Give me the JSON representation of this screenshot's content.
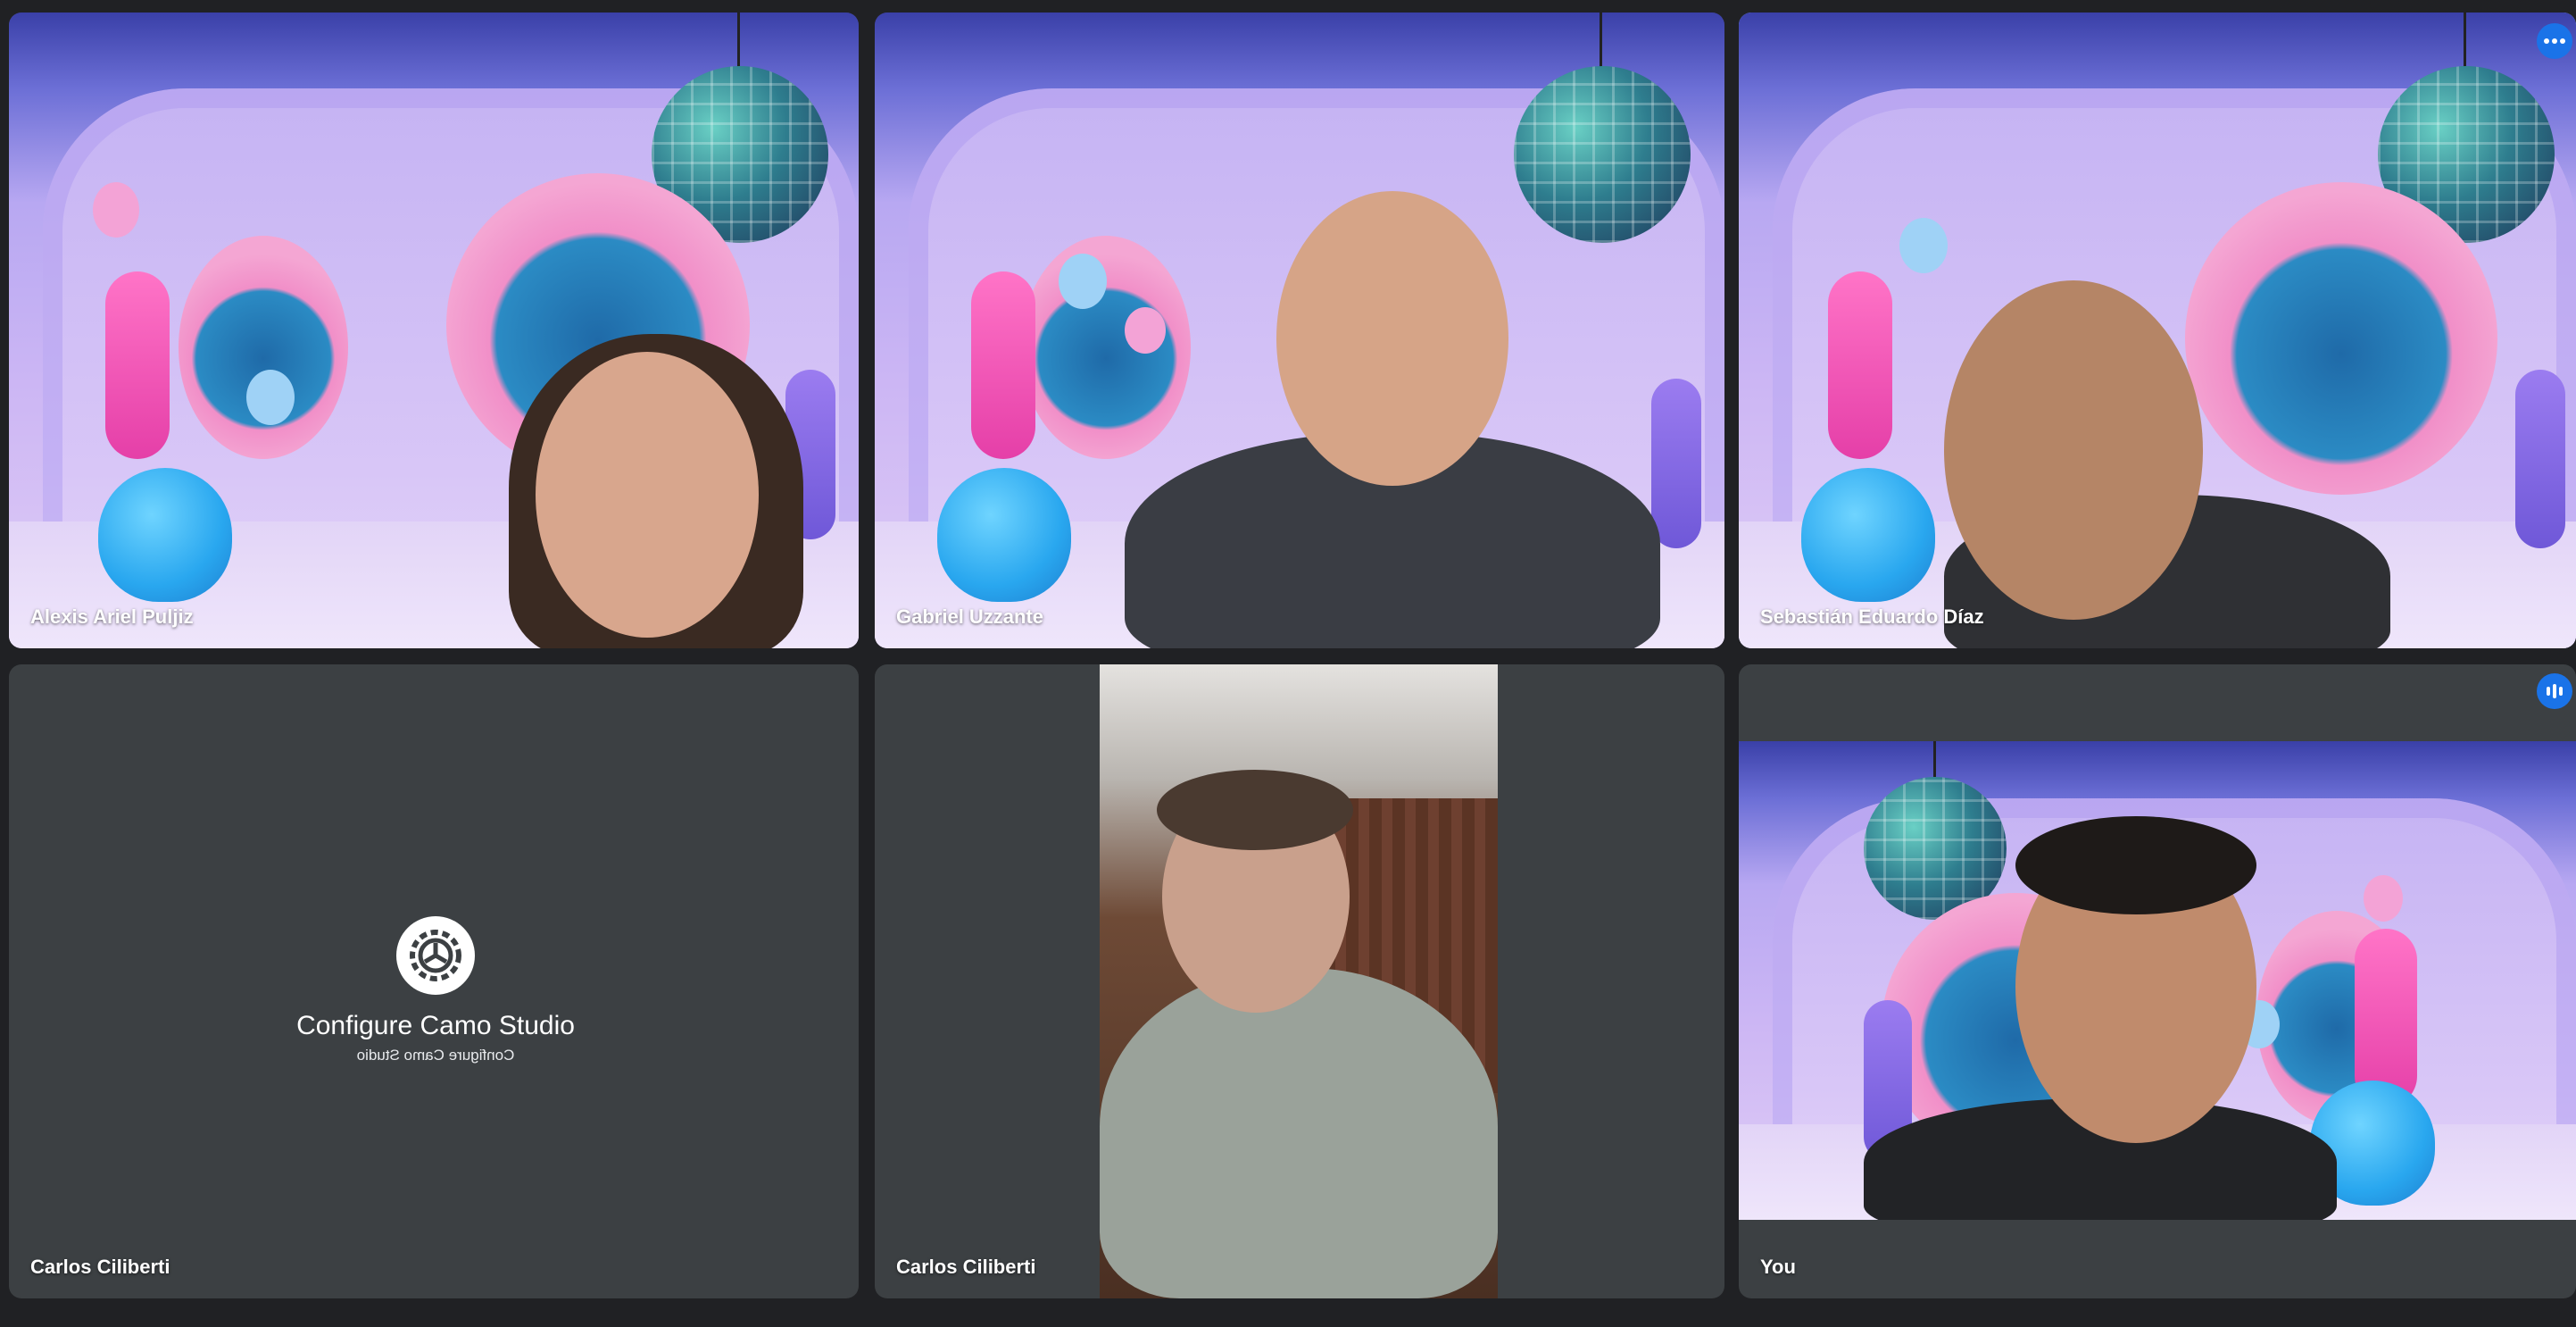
{
  "participants": [
    {
      "name": "Alexis Ariel Puljiz",
      "type": "video",
      "background": "party"
    },
    {
      "name": "Gabriel Uzzante",
      "type": "video",
      "background": "party"
    },
    {
      "name": "Sebastián Eduardo Díaz",
      "type": "video",
      "background": "party",
      "active_speaker": true
    },
    {
      "name": "Carlos Ciliberti",
      "type": "camo-placeholder",
      "camo_title": "Configure Camo Studio",
      "camo_subtitle": "Configure Camo Studio"
    },
    {
      "name": "Carlos Ciliberti",
      "type": "video",
      "background": "room"
    },
    {
      "name": "You",
      "type": "video",
      "background": "party"
    }
  ],
  "icons": {
    "more_options": "more-options-icon",
    "audio_level": "audio-level-icon"
  },
  "colors": {
    "page_background": "#202124",
    "tile_background": "#3c4043",
    "active_border": "#8ab4f8",
    "accent": "#1a73e8"
  }
}
